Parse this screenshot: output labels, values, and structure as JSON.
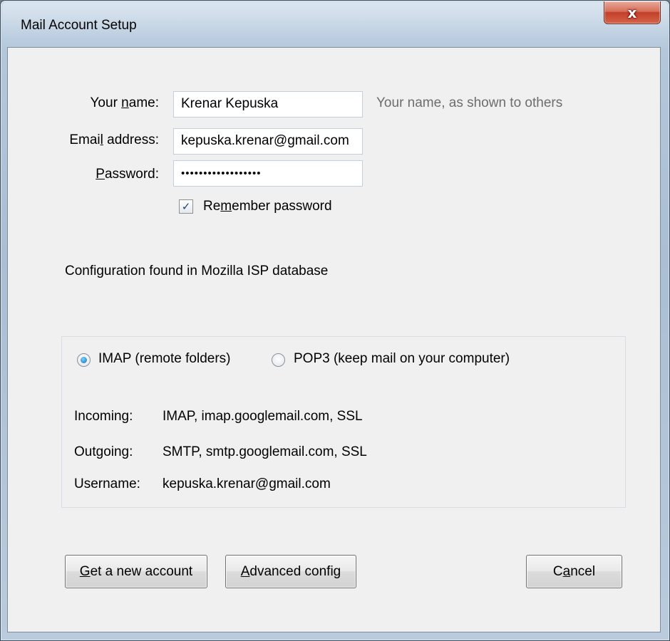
{
  "window": {
    "title": "Mail Account Setup",
    "close_glyph": "x"
  },
  "form": {
    "name_label_pre": "Your ",
    "name_label_key": "n",
    "name_label_post": "ame:",
    "name_value": "Krenar Kepuska",
    "name_hint": "Your name, as shown to others",
    "email_label_pre": "Emai",
    "email_label_key": "l",
    "email_label_post": " address:",
    "email_value": "kepuska.krenar@gmail.com",
    "password_label_key": "P",
    "password_label_post": "assword:",
    "password_value": "••••••••••••••••••",
    "remember_pre": "Re",
    "remember_key": "m",
    "remember_post": "ember password",
    "remember_checked": true
  },
  "status": {
    "config_message": "Configuration found in Mozilla ISP database"
  },
  "server": {
    "imap_label": "IMAP (remote folders)",
    "pop3_label": "POP3 (keep mail on your computer)",
    "selected": "IMAP",
    "incoming_label": "Incoming:",
    "incoming_value": "IMAP, imap.googlemail.com, SSL",
    "outgoing_label": "Outgoing:",
    "outgoing_value": "SMTP, smtp.googlemail.com, SSL",
    "username_label": "Username:",
    "username_value": "kepuska.krenar@gmail.com"
  },
  "buttons": {
    "new_account_key": "G",
    "new_account_post": "et a new account",
    "advanced_key": "A",
    "advanced_post": "dvanced config",
    "cancel_pre": "C",
    "cancel_key": "a",
    "cancel_post": "ncel"
  },
  "icons": {
    "checkbox_mark": "✓"
  }
}
